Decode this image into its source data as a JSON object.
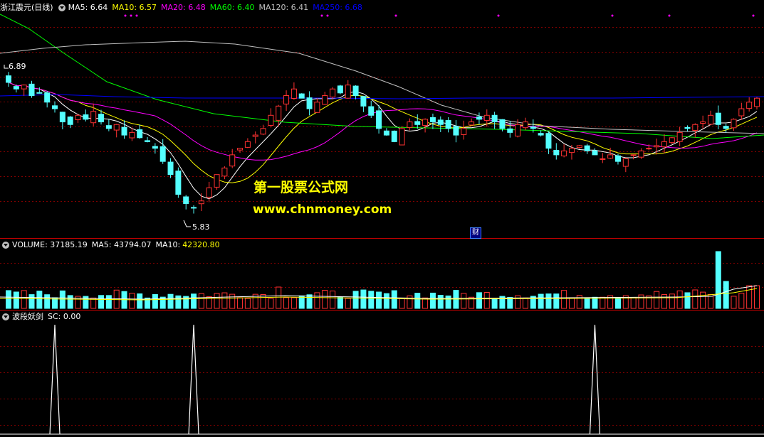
{
  "price_panel": {
    "title": "浙江震元(日线)",
    "ma_labels": [
      {
        "text": "MA5: 6.64",
        "color": "#ffffff"
      },
      {
        "text": "MA10: 6.57",
        "color": "#ffff00"
      },
      {
        "text": "MA20: 6.48",
        "color": "#ff00ff"
      },
      {
        "text": "MA60: 6.40",
        "color": "#00ff00"
      },
      {
        "text": "MA120: 6.41",
        "color": "#c0c0c0"
      },
      {
        "text": "MA250: 6.68",
        "color": "#0000ff"
      }
    ],
    "high_label": "6.89",
    "low_label": "5.83",
    "finance_marker": "财",
    "watermark_title": "第一股票公式网",
    "watermark_url": "www.chnmoney.com"
  },
  "volume_panel": {
    "title": "VOLUME: 37185.19",
    "ma5": "MA5: 43794.07",
    "ma10_label": "MA10:",
    "ma10_value": "42320.80"
  },
  "indicator_panel": {
    "title": "波段妖剑",
    "sc": "SC: 0.00"
  },
  "colors": {
    "up": "#ff3232",
    "down": "#54ffff",
    "grid": "#800000",
    "border": "#c00000"
  },
  "chart_data": [
    {
      "type": "candlestick",
      "title": "浙江震元(日线)",
      "ylim": [
        5.7,
        7.1
      ],
      "high": 6.89,
      "low": 5.83,
      "last_close": 6.68,
      "moving_averages": {
        "MA5": 6.64,
        "MA10": 6.57,
        "MA20": 6.48,
        "MA60": 6.4,
        "MA120": 6.41,
        "MA250": 6.68
      },
      "closes": [
        6.8,
        6.75,
        6.78,
        6.7,
        6.72,
        6.65,
        6.6,
        6.5,
        6.48,
        6.55,
        6.52,
        6.58,
        6.5,
        6.45,
        6.48,
        6.4,
        6.42,
        6.38,
        6.35,
        6.3,
        6.2,
        6.1,
        5.95,
        5.88,
        5.85,
        5.9,
        6.0,
        6.1,
        6.15,
        6.25,
        6.3,
        6.35,
        6.4,
        6.45,
        6.55,
        6.62,
        6.7,
        6.75,
        6.68,
        6.6,
        6.65,
        6.7,
        6.75,
        6.72,
        6.78,
        6.7,
        6.62,
        6.55,
        6.45,
        6.4,
        6.35,
        6.45,
        6.5,
        6.48,
        6.52,
        6.5,
        6.48,
        6.45,
        6.4,
        6.45,
        6.5,
        6.52,
        6.55,
        6.5,
        6.45,
        6.42,
        6.48,
        6.5,
        6.45,
        6.4,
        6.3,
        6.25,
        6.28,
        6.3,
        6.32,
        6.28,
        6.25,
        6.22,
        6.25,
        6.2,
        6.22,
        6.25,
        6.28,
        6.3,
        6.32,
        6.35,
        6.38,
        6.42,
        6.45,
        6.48,
        6.5,
        6.55,
        6.48,
        6.45,
        6.52,
        6.6,
        6.65,
        6.68
      ]
    },
    {
      "type": "bar",
      "title": "VOLUME",
      "value": 37185.19,
      "MA5": 43794.07,
      "MA10": 42320.8
    },
    {
      "type": "line",
      "title": "波段妖剑",
      "SC": 0.0,
      "spike_indices": [
        6,
        24,
        76
      ]
    }
  ]
}
